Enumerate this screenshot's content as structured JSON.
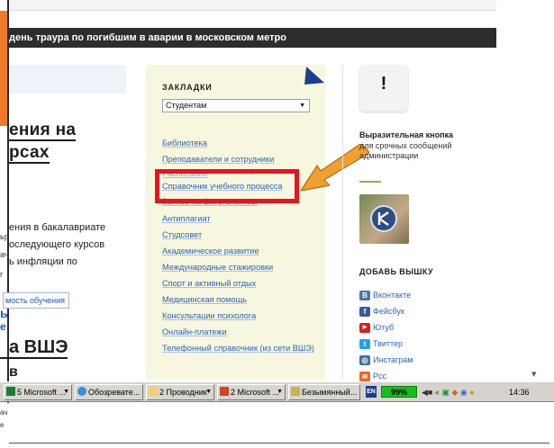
{
  "news_bar": {
    "text": "день траура по погибшим в аварии в московском метро"
  },
  "left_content": {
    "heading_line1": "ения на",
    "heading_line2": "рсах",
    "body_lines": [
      "ения в бакалавриате",
      "оследующего курсов",
      "ь инфляции по"
    ],
    "cost_button": "мость обучения",
    "blue_fragment1": "ь",
    "blue_fragment2": "е",
    "hse_heading": "а ВШЭ",
    "hse_heading2": "в",
    "side_fragments": [
      "ьр",
      "ач",
      "г",
      "ач",
      "е"
    ]
  },
  "bookmarks": {
    "title": "ЗАКЛАДКИ",
    "selected": "Студентам",
    "items": [
      "Библиотека",
      "Преподаватели и сотрудники",
      "Расписание",
      "Справочник учебного процесса",
      "Запись на факультативы",
      "Антиплагиат",
      "Студсовет",
      "Академическое развитие",
      "Международные стажировки",
      "Спорт и активный отдых",
      "Медицинская помощь",
      "Консультации психолога",
      "Онлайн-платежи",
      "Телефонный справочник (из сети ВШЭ)"
    ]
  },
  "alert": {
    "mark": "!",
    "title": "Выразительная кнопка",
    "description": "для срочных сообщений администрации"
  },
  "add_hse": {
    "title": "ДОБАВЬ ВЫШКУ",
    "links": [
      {
        "label": "Вконтакте",
        "icon": "vk-icon",
        "color": "#4a76a8",
        "glyph": "В"
      },
      {
        "label": "Фейсбук",
        "icon": "facebook-icon",
        "color": "#3b5998",
        "glyph": "f"
      },
      {
        "label": "Ютуб",
        "icon": "youtube-icon",
        "color": "#d4201a",
        "glyph": "▶"
      },
      {
        "label": "Твиттер",
        "icon": "twitter-icon",
        "color": "#1da1f2",
        "glyph": "t"
      },
      {
        "label": "Инстаграм",
        "icon": "instagram-icon",
        "color": "#3f729b",
        "glyph": "◎"
      },
      {
        "label": "Рсс",
        "icon": "rss-icon",
        "color": "#f26522",
        "glyph": "≋"
      }
    ]
  },
  "taskbar": {
    "tasks": [
      {
        "label": "5 Microsoft ...",
        "icon": "excel-icon"
      },
      {
        "label": "Обозревате...",
        "icon": "explorer-icon"
      },
      {
        "label": "2 Проводник",
        "icon": "folder-icon"
      },
      {
        "label": "2 Microsoft ...",
        "icon": "powerpoint-icon"
      },
      {
        "label": "Безымянный...",
        "icon": "paint-icon"
      }
    ],
    "language": "EN",
    "battery": "99%",
    "clock": "14:36"
  },
  "colors": {
    "highlight_box": "#e8141b",
    "arrow": "#f0a030",
    "bookmarks_bg": "#f7f7df",
    "link": "#2a63bd"
  }
}
